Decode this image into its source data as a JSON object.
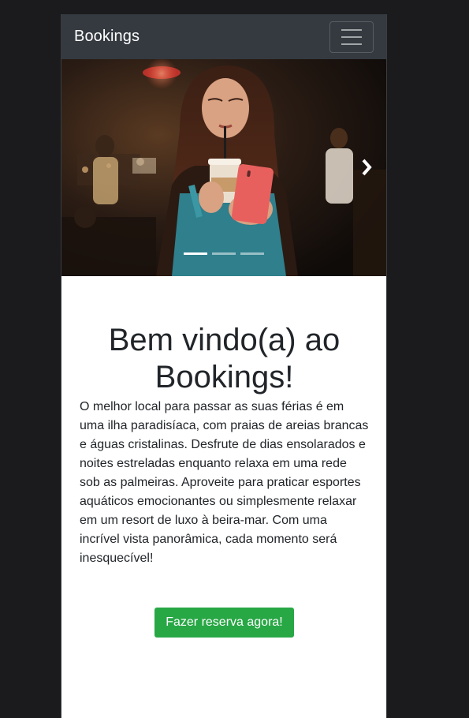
{
  "navbar": {
    "brand": "Bookings",
    "toggler_icon": "hamburger-menu-icon"
  },
  "carousel": {
    "image_description_icon": "photo",
    "next_icon": "chevron-right-icon",
    "indicators": [
      {
        "active": true
      },
      {
        "active": false
      },
      {
        "active": false
      }
    ]
  },
  "main": {
    "title": "Bem vindo(a) ao Bookings!",
    "paragraph": "O melhor local para passar as suas férias é em uma ilha paradisíaca, com praias de areias brancas e águas cristalinas. Desfrute de dias ensolarados e noites estreladas enquanto relaxa em uma rede sob as palmeiras. Aproveite para praticar esportes aquáticos emocionantes ou simplesmente relaxar em um resort de luxo à beira-mar. Com uma incrível vista panorâmica, cada momento será inesquecível!",
    "cta_label": "Fazer reserva agora!"
  },
  "colors": {
    "navbar_bg": "#343a40",
    "page_bg": "#1b1b1d",
    "cta_bg": "#28a745"
  }
}
